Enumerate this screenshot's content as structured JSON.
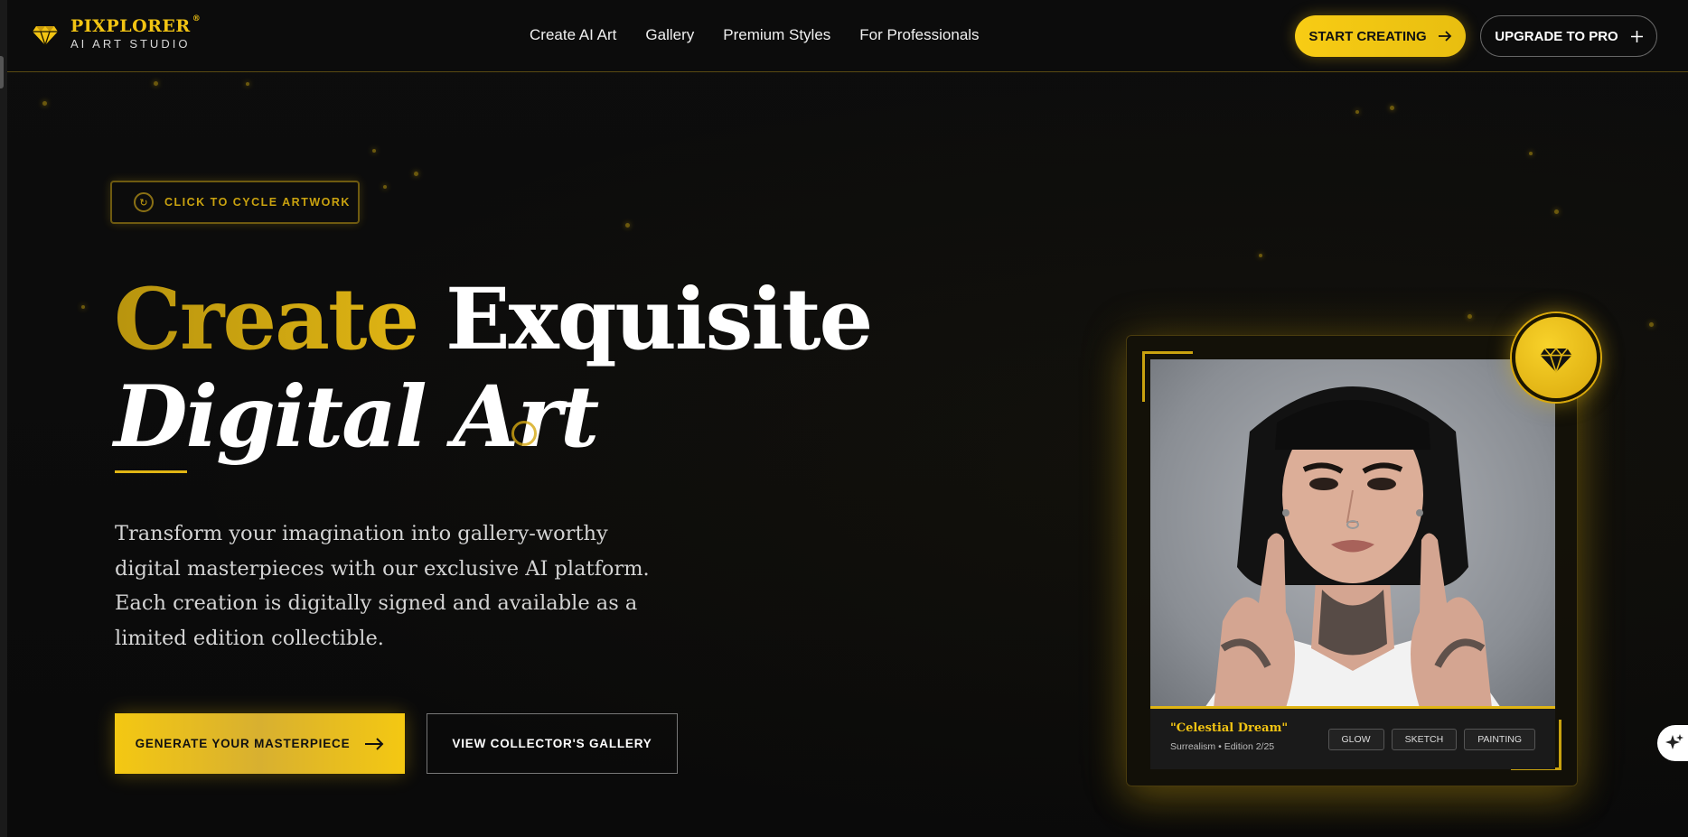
{
  "brand": {
    "name": "PIXPLORER",
    "registered": "®",
    "tagline": "AI ART STUDIO",
    "accent_color": "#f2c413"
  },
  "nav": {
    "links": [
      "Create AI Art",
      "Gallery",
      "Premium Styles",
      "For Professionals"
    ],
    "start_label": "START CREATING",
    "upgrade_label": "UPGRADE TO PRO"
  },
  "hero": {
    "cycle_label": "CLICK TO CYCLE ARTWORK",
    "headline_gold": "Create",
    "headline_white": "Exquisite",
    "headline_line2": "Digital Art",
    "description": "Transform your imagination into gallery-worthy digital masterpieces with our exclusive AI platform. Each creation is digitally signed and available as a limited edition collectible.",
    "primary_cta": "GENERATE YOUR MASTERPIECE",
    "secondary_cta": "VIEW COLLECTOR'S GALLERY"
  },
  "artwork": {
    "title": "\"Celestial Dream\"",
    "subtitle": "Surrealism • Edition 2/25",
    "tags": [
      "GLOW",
      "SKETCH",
      "PAINTING"
    ],
    "badge_icon": "diamond-icon"
  },
  "icons": {
    "logo": "diamond-icon",
    "arrow": "arrow-right-icon",
    "plus": "plus-icon",
    "cycle": "refresh-icon",
    "assistant": "sparkle-icon"
  }
}
